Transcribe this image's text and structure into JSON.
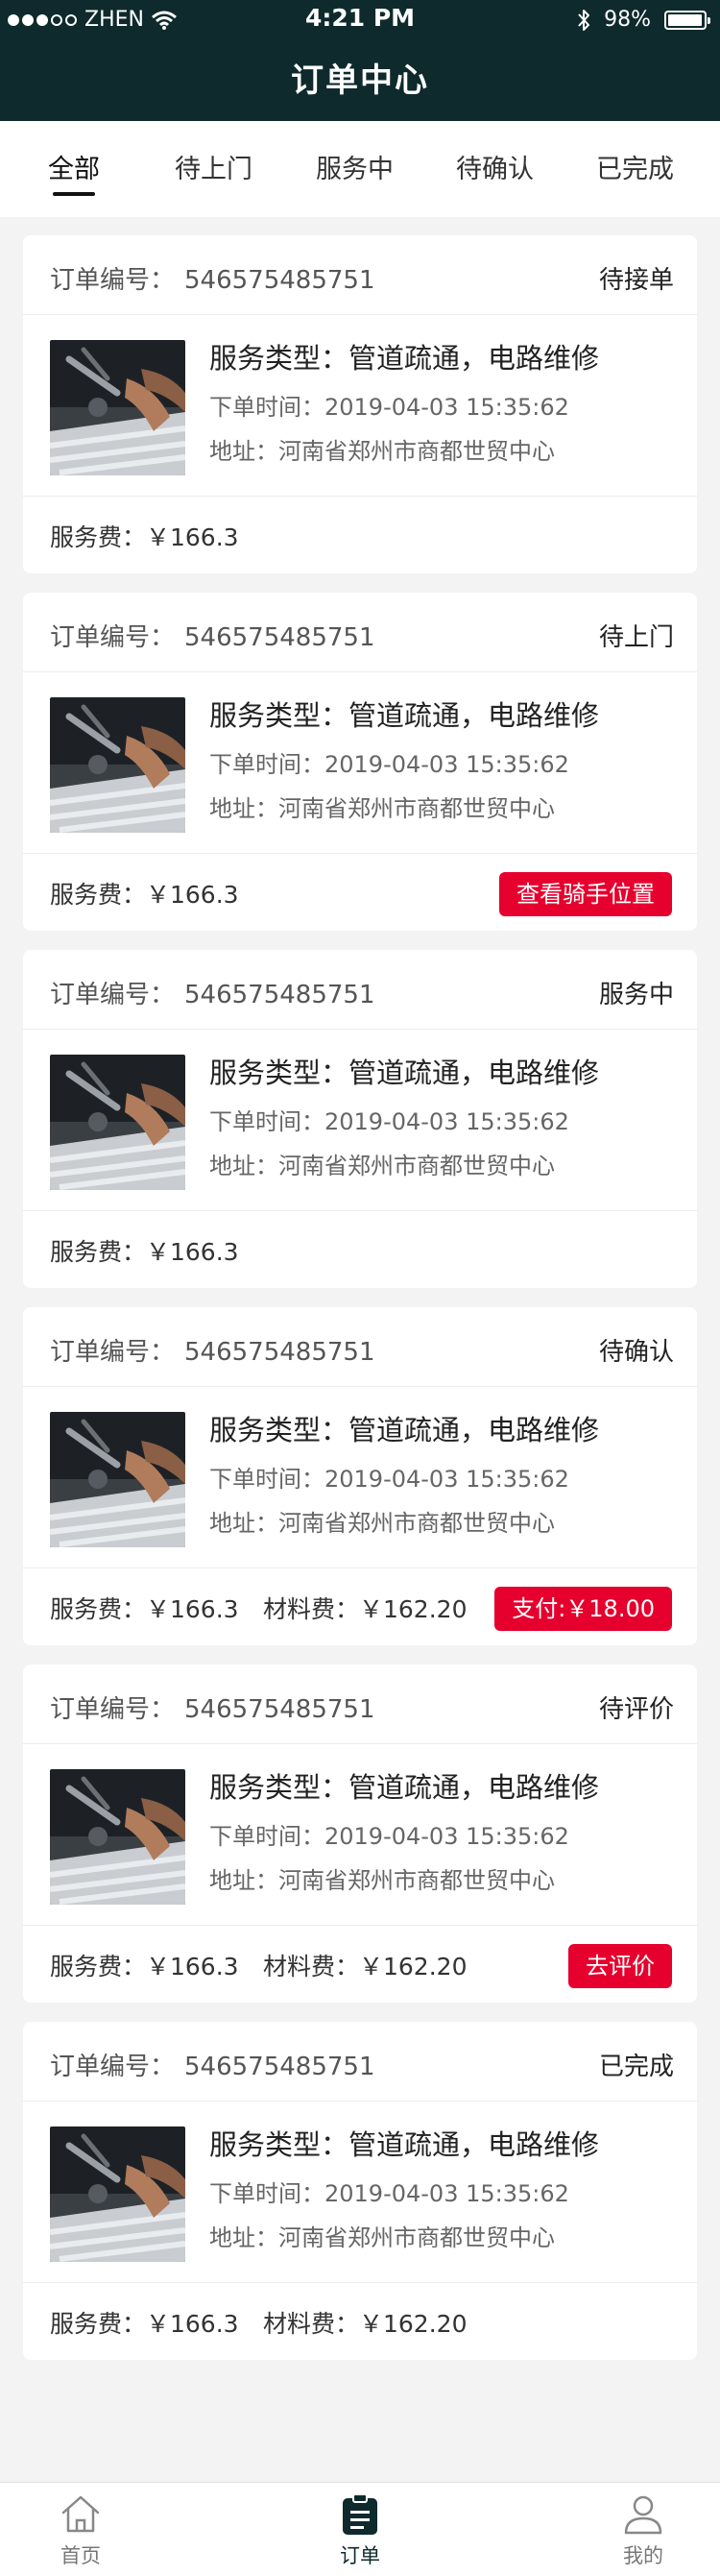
{
  "status_bar": {
    "carrier": "ZHEN",
    "time": "4:21 PM",
    "battery": "98%",
    "battery_level": 0.98
  },
  "header": {
    "title": "订单中心"
  },
  "tabs": [
    {
      "label": "全部",
      "active": true
    },
    {
      "label": "待上门"
    },
    {
      "label": "服务中"
    },
    {
      "label": "待确认"
    },
    {
      "label": "已完成"
    }
  ],
  "orders": [
    {
      "order_no_label": "订单编号：",
      "order_no": "546575485751",
      "status": "待接单",
      "service_type": "服务类型：管道疏通，电路维修",
      "order_time": "下单时间：2019-04-03  15:35:62",
      "address": "地址：河南省郑州市商都世贸中心",
      "fee": "服务费：￥166.3",
      "material": "",
      "action": ""
    },
    {
      "order_no_label": "订单编号：",
      "order_no": "546575485751",
      "status": "待上门",
      "service_type": "服务类型：管道疏通，电路维修",
      "order_time": "下单时间：2019-04-03  15:35:62",
      "address": "地址：河南省郑州市商都世贸中心",
      "fee": "服务费：￥166.3",
      "material": "",
      "action": "查看骑手位置"
    },
    {
      "order_no_label": "订单编号：",
      "order_no": "546575485751",
      "status": "服务中",
      "service_type": "服务类型：管道疏通，电路维修",
      "order_time": "下单时间：2019-04-03  15:35:62",
      "address": "地址：河南省郑州市商都世贸中心",
      "fee": "服务费：￥166.3",
      "material": "",
      "action": ""
    },
    {
      "order_no_label": "订单编号：",
      "order_no": "546575485751",
      "status": "待确认",
      "service_type": "服务类型：管道疏通，电路维修",
      "order_time": "下单时间：2019-04-03  15:35:62",
      "address": "地址：河南省郑州市商都世贸中心",
      "fee": "服务费：￥166.3",
      "material": "材料费：￥162.20",
      "action": "支付:￥18.00"
    },
    {
      "order_no_label": "订单编号：",
      "order_no": "546575485751",
      "status": "待评价",
      "service_type": "服务类型：管道疏通，电路维修",
      "order_time": "下单时间：2019-04-03  15:35:62",
      "address": "地址：河南省郑州市商都世贸中心",
      "fee": "服务费：￥166.3",
      "material": "材料费：￥162.20",
      "action": "去评价"
    },
    {
      "order_no_label": "订单编号：",
      "order_no": "546575485751",
      "status": "已完成",
      "service_type": "服务类型：管道疏通，电路维修",
      "order_time": "下单时间：2019-04-03  15:35:62",
      "address": "地址：河南省郑州市商都世贸中心",
      "fee": "服务费：￥166.3",
      "material": "材料费：￥162.20",
      "action": ""
    }
  ],
  "bottom_nav": [
    {
      "label": "首页",
      "icon": "home-icon"
    },
    {
      "label": "订单",
      "icon": "orders-icon",
      "active": true
    },
    {
      "label": "我的",
      "icon": "user-icon"
    }
  ],
  "colors": {
    "header_bg": "#0e2a2c",
    "accent": "#e6002d",
    "page_bg": "#f3f3f3"
  }
}
